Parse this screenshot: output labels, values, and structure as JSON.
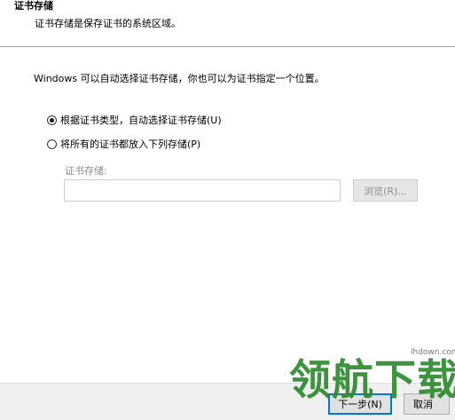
{
  "header": {
    "title": "证书存储",
    "description": "证书存储是保存证书的系统区域。"
  },
  "main": {
    "intro": "Windows 可以自动选择证书存储，你也可以为证书指定一个位置。",
    "options": [
      {
        "label": "根据证书类型，自动选择证书存储(U)",
        "selected": true
      },
      {
        "label": "将所有的证书都放入下列存储(P)",
        "selected": false
      }
    ],
    "store_label": "证书存储:",
    "store_value": "",
    "browse_label": "浏览(R)..."
  },
  "footer": {
    "next_label": "下一步(N)",
    "cancel_label": "取消"
  },
  "watermark": {
    "logo_text": "领航下载",
    "domain": "lhdown.com"
  },
  "colors": {
    "accent": "#0078d7",
    "watermark": "#2e8b2e"
  }
}
